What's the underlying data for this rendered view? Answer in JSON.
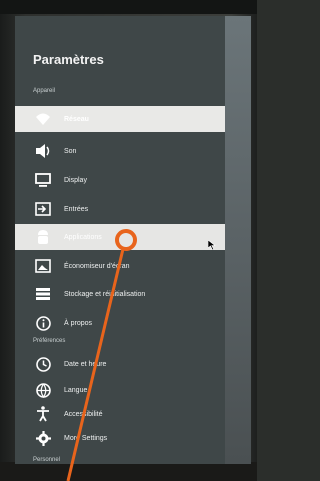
{
  "panel": {
    "title": "Paramètres",
    "sections": {
      "appareil": "Appareil",
      "preferences": "Préférences",
      "personnel": "Personnel"
    },
    "items": [
      {
        "label": "Réseau",
        "icon": "wifi-icon"
      },
      {
        "label": "Son",
        "icon": "speaker-icon"
      },
      {
        "label": "Display",
        "icon": "monitor-icon"
      },
      {
        "label": "Entrées",
        "icon": "input-icon"
      },
      {
        "label": "Applications",
        "icon": "android-icon"
      },
      {
        "label": "Économiseur d'écran",
        "icon": "screensaver-icon"
      },
      {
        "label": "Stockage et réinitialisation",
        "icon": "storage-icon"
      },
      {
        "label": "À propos",
        "icon": "info-icon"
      },
      {
        "label": "Date et heure",
        "icon": "clock-icon"
      },
      {
        "label": "Langue",
        "icon": "globe-icon"
      },
      {
        "label": "Accessibilité",
        "icon": "accessibility-icon"
      },
      {
        "label": "More Settings",
        "icon": "gear-icon"
      }
    ]
  },
  "colors": {
    "panel_bg": "#3f4748",
    "highlight": "#e9e9e7",
    "pointer": "#e8641c"
  }
}
